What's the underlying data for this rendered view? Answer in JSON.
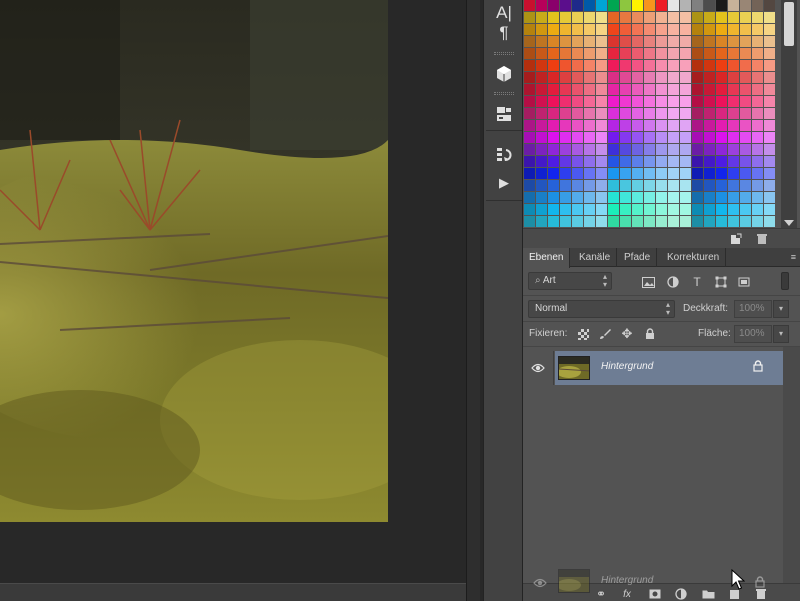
{
  "tool_strip": {
    "icons": [
      "character-icon",
      "paragraph-icon",
      "3d-icon",
      "properties-icon",
      "history-icon",
      "actions-icon"
    ],
    "character_glyph": "A|",
    "paragraph_glyph": "¶",
    "play_glyph": "▶"
  },
  "layers_panel": {
    "tabs": [
      {
        "label": "Ebenen",
        "active": true
      },
      {
        "label": "Kanäle",
        "active": false
      },
      {
        "label": "Pfade",
        "active": false
      },
      {
        "label": "Korrekturen",
        "active": false
      }
    ],
    "filter": {
      "label": "Art"
    },
    "blend_mode": "Normal",
    "opacity": {
      "label": "Deckkraft:",
      "value": "100%"
    },
    "lock_label": "Fixieren:",
    "fill": {
      "label": "Fläche:",
      "value": "100%"
    },
    "layers": [
      {
        "name": "Hintergrund",
        "visible": true,
        "locked": true,
        "selected": true
      }
    ],
    "drag_ghost": {
      "name": "Hintergrund"
    }
  },
  "colors": {
    "panel_bg": "#535353",
    "selected_layer": "#6e7d94",
    "canvas_bg": "#282828"
  }
}
